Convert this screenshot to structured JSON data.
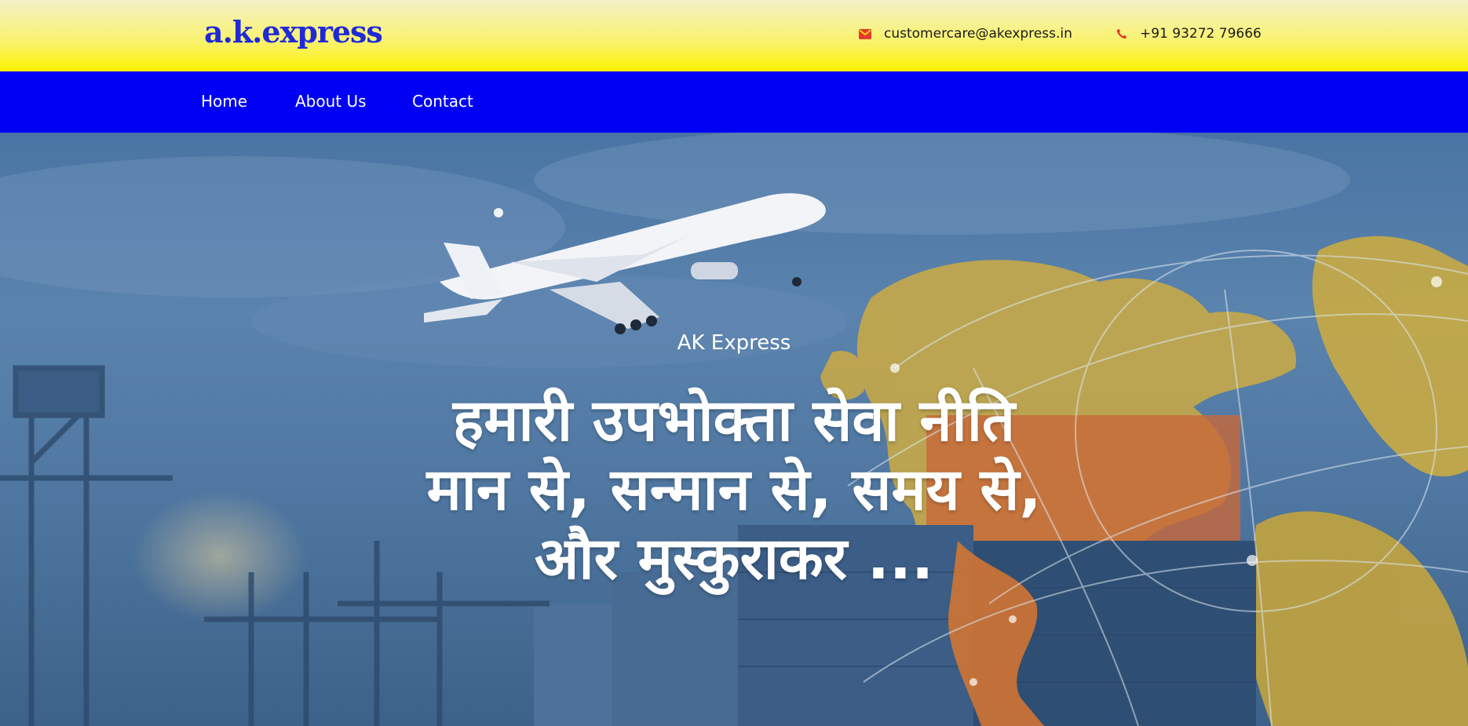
{
  "header": {
    "logo": "a.k.express",
    "email": "customercare@akexpress.in",
    "phone": "+91 93272 79666"
  },
  "nav": {
    "items": [
      "Home",
      "About Us",
      "Contact"
    ]
  },
  "hero": {
    "subtitle": "AK Express",
    "title_lines": [
      "हमारी उपभोक्ता सेवा नीति",
      "मान से, सन्मान से, समय से,",
      "और मुस्कुराकर ..."
    ]
  },
  "icons": {
    "email": "envelope-icon",
    "phone": "phone-icon"
  },
  "colors": {
    "nav_bg": "#0000f5",
    "logo": "#1f2ad6",
    "icon_accent": "#e53b2f",
    "hero_overlay": "#4f77a1"
  }
}
